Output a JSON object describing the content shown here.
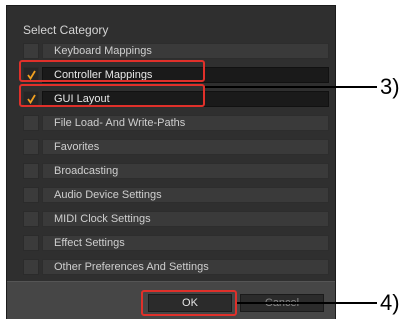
{
  "dialog": {
    "heading": "Select Category",
    "items": [
      {
        "label": "Keyboard Mappings",
        "checked": false
      },
      {
        "label": "Controller Mappings",
        "checked": true
      },
      {
        "label": "GUI Layout",
        "checked": true
      },
      {
        "label": "File Load- And Write-Paths",
        "checked": false
      },
      {
        "label": "Favorites",
        "checked": false
      },
      {
        "label": "Broadcasting",
        "checked": false
      },
      {
        "label": "Audio Device Settings",
        "checked": false
      },
      {
        "label": "MIDI Clock Settings",
        "checked": false
      },
      {
        "label": "Effect Settings",
        "checked": false
      },
      {
        "label": "Other Preferences And Settings",
        "checked": false
      }
    ],
    "ok_label": "OK",
    "cancel_label": "Cancel"
  },
  "callouts": {
    "label_3": "3)",
    "label_4": "4)"
  },
  "colors": {
    "highlight": "#e0302a",
    "checkmark": "#f0a020"
  }
}
